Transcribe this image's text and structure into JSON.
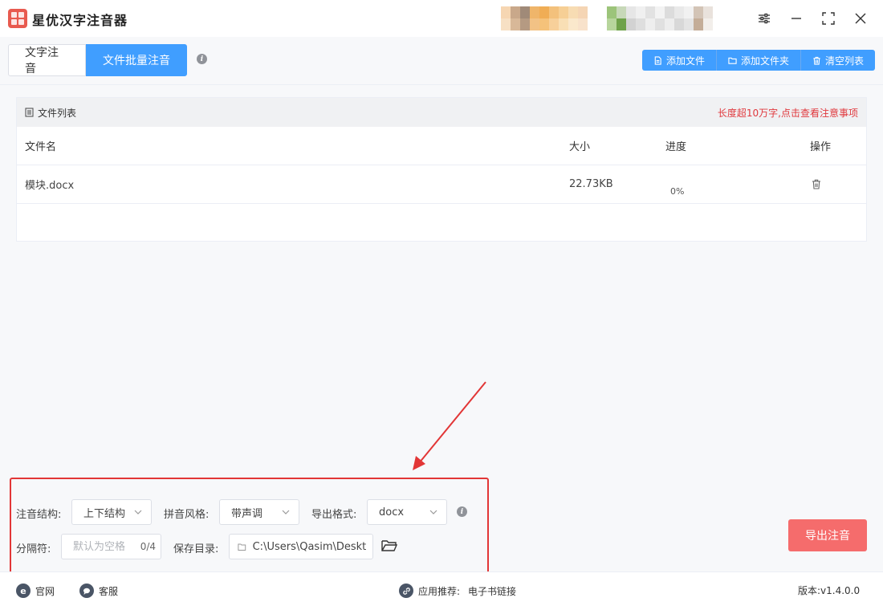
{
  "window": {
    "title": "星优汉字注音器"
  },
  "tabs": [
    {
      "label": "文字注音",
      "active": false
    },
    {
      "label": "文件批量注音",
      "active": true
    }
  ],
  "toolbar": {
    "add_file": "添加文件",
    "add_folder": "添加文件夹",
    "clear_list": "清空列表"
  },
  "file_panel": {
    "title": "文件列表",
    "notice": "长度超10万字,点击查看注意事项",
    "columns": {
      "name": "文件名",
      "size": "大小",
      "progress": "进度",
      "action": "操作"
    },
    "rows": [
      {
        "name": "模块.docx",
        "size": "22.73KB",
        "progress_text": "0%",
        "progress_value": 0
      }
    ]
  },
  "settings": {
    "structure_label": "注音结构:",
    "structure_value": "上下结构",
    "style_label": "拼音风格:",
    "style_value": "带声调",
    "format_label": "导出格式:",
    "format_value": "docx",
    "separator_label": "分隔符:",
    "separator_placeholder": "默认为空格",
    "separator_value": "",
    "separator_count": "0/4",
    "save_dir_label": "保存目录:",
    "save_dir_value": "C:\\Users\\Qasim\\Desktop"
  },
  "export_button": "导出注音",
  "footer": {
    "website": "官网",
    "support": "客服",
    "recommend_label": "应用推荐:",
    "recommend_link": "电子书链接",
    "version": "版本:v1.4.0.0"
  },
  "colors": {
    "primary": "#409eff",
    "danger": "#f56c6c",
    "notice": "#e0393e",
    "highlight_box": "#e23636"
  }
}
